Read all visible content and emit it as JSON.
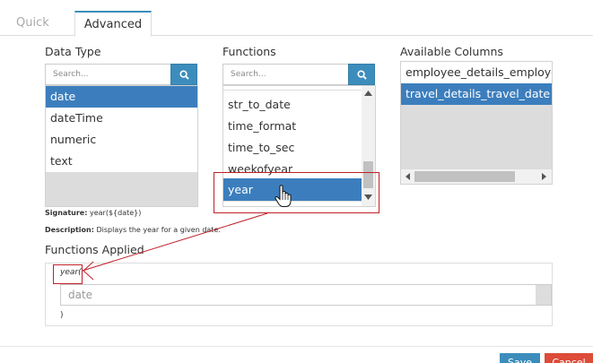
{
  "tabs": {
    "quick": "Quick",
    "advanced": "Advanced"
  },
  "data_type": {
    "label": "Data Type",
    "search_placeholder": "Search...",
    "items": [
      "date",
      "dateTime",
      "numeric",
      "text"
    ],
    "selected": "date"
  },
  "functions": {
    "label": "Functions",
    "search_placeholder": "Search...",
    "items": [
      "str_to_date",
      "time_format",
      "time_to_sec",
      "weekofyear",
      "year"
    ],
    "selected": "year"
  },
  "columns": {
    "label": "Available Columns",
    "items": [
      "employee_details_employee_",
      "travel_details_travel_date"
    ],
    "selected": "travel_details_travel_date"
  },
  "signature": {
    "label": "Signature:",
    "value": "year(${date})"
  },
  "description": {
    "label": "Description:",
    "value": "Displays the year for a given date."
  },
  "applied": {
    "label": "Functions Applied",
    "func_name": "year(",
    "param_placeholder": "date",
    "close_paren": ")"
  },
  "buttons": {
    "save": "Save",
    "cancel": "Cancel"
  },
  "colors": {
    "accent": "#3c8dbc",
    "selected": "#3c7ebd",
    "annotation": "#c0202a",
    "cancel": "#dd4b39"
  }
}
